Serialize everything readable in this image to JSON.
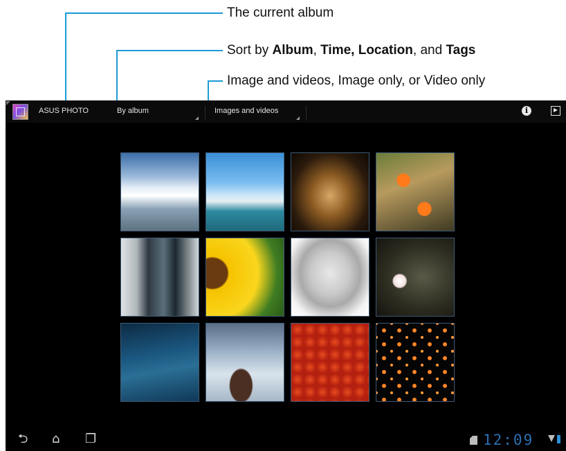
{
  "callouts": {
    "current_album": "The current album",
    "sort_by": {
      "prefix": "Sort by ",
      "album": "Album",
      "sep1": ", ",
      "time_location": "Time, Location",
      "sep2": ", and ",
      "tags": "Tags"
    },
    "media_filter": "Image and videos, Image only, or Video only"
  },
  "actionbar": {
    "app_title": "ASUS PHOTO",
    "sort_spinner": "By album",
    "filter_spinner": "Images and videos"
  },
  "grid": {
    "thumbnails": [
      {
        "icon": "cloudy-sky-photo"
      },
      {
        "icon": "harbor-boats-photo"
      },
      {
        "icon": "lit-arcade-photo"
      },
      {
        "icon": "clownfish-anemone-photo"
      },
      {
        "icon": "couple-walking-photo"
      },
      {
        "icon": "sunflower-photo"
      },
      {
        "icon": "sleeping-kitten-photo"
      },
      {
        "icon": "white-blossom-photo"
      },
      {
        "icon": "blue-water-photo"
      },
      {
        "icon": "misty-rock-photo"
      },
      {
        "icon": "red-lanterns-photo"
      },
      {
        "icon": "sky-lanterns-photo"
      }
    ]
  },
  "statusbar": {
    "clock": "12:09"
  },
  "colors": {
    "callout": "#1a9ad6",
    "screen_bg": "#000000",
    "clock": "#2a6fb0"
  }
}
